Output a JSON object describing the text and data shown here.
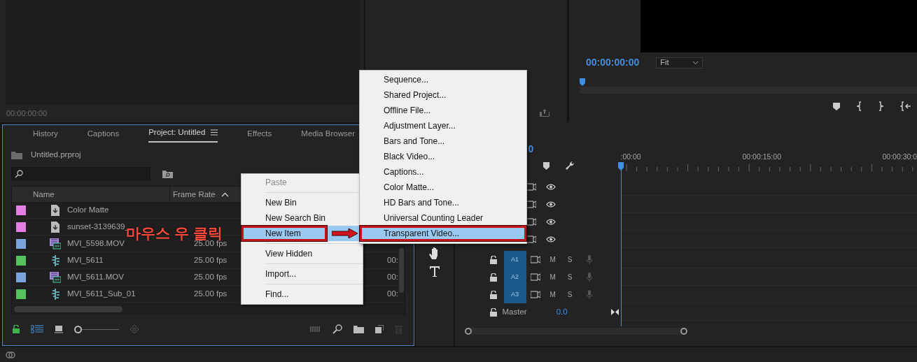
{
  "source_monitor": {
    "timecode": "00:00:00:00"
  },
  "program_monitor": {
    "timecode": "00:00:00:00",
    "zoom": "Fit",
    "scrub": {
      "level": 0
    }
  },
  "project_panel": {
    "tabs": [
      {
        "label": "History",
        "selected": false
      },
      {
        "label": "Captions",
        "selected": false
      },
      {
        "label": "Project: Untitled",
        "selected": true
      },
      {
        "label": "Effects",
        "selected": false
      },
      {
        "label": "Media Browser",
        "selected": false
      }
    ],
    "file": "Untitled.prproj",
    "columns": [
      "Name",
      "Frame Rate"
    ],
    "rows": [
      {
        "name": "Color Matte",
        "kind": "matte",
        "color": "#e27fe0"
      },
      {
        "name": "sunset-3139639_",
        "kind": "matte",
        "color": "#e27fe0"
      },
      {
        "name": "MVI_5598.MOV",
        "kind": "clip",
        "color": "#7ea3dc",
        "frame_rate": "25.00 fps"
      },
      {
        "name": "MVI_5611",
        "kind": "sequence",
        "color": "#55c25f",
        "frame_rate": "25.00 fps",
        "column_3": "00:"
      },
      {
        "name": "MVI_5611.MOV",
        "kind": "clip",
        "color": "#7ea3dc",
        "frame_rate": "25.00 fps",
        "column_3": "00:"
      },
      {
        "name": "MVI_5611_Sub_01",
        "kind": "sequence",
        "color": "#55c25f",
        "frame_rate": "25.00 fps",
        "column_3": "00:"
      }
    ],
    "icon_size": {
      "level": 0
    }
  },
  "timeline": {
    "timecode": "0",
    "ruler": [
      ":00:00",
      "00:00:15:00",
      "00:00:30:0"
    ],
    "video_tracks": [
      {
        "visible": true
      },
      {
        "visible": true
      },
      {
        "visible": true
      },
      {
        "visible": true
      }
    ],
    "audio_tracks": [
      {
        "label": "A1",
        "mute": "M",
        "solo": "S"
      },
      {
        "label": "A2",
        "mute": "M",
        "solo": "S"
      },
      {
        "label": "A3",
        "mute": "M",
        "solo": "S"
      }
    ],
    "master": {
      "label": "Master",
      "value": "0.0"
    }
  },
  "context_menu": {
    "items": [
      {
        "kind": "item",
        "label": "Paste",
        "disabled": true,
        "selected": false
      },
      {
        "kind": "separator"
      },
      {
        "kind": "item",
        "label": "New Bin",
        "disabled": false,
        "selected": false
      },
      {
        "kind": "item",
        "label": "New Search Bin",
        "disabled": false,
        "selected": false
      },
      {
        "kind": "item",
        "label": "New Item",
        "disabled": false,
        "selected": true
      },
      {
        "kind": "separator"
      },
      {
        "kind": "item",
        "label": "View Hidden",
        "disabled": false,
        "selected": false
      },
      {
        "kind": "separator"
      },
      {
        "kind": "item",
        "label": "Import...",
        "disabled": false,
        "selected": false
      },
      {
        "kind": "separator"
      },
      {
        "kind": "item",
        "label": "Find...",
        "disabled": false,
        "selected": false
      }
    ]
  },
  "submenu": {
    "items": [
      {
        "kind": "item",
        "label": "Sequence...",
        "selected": false
      },
      {
        "kind": "item",
        "label": "Shared Project...",
        "selected": false
      },
      {
        "kind": "item",
        "label": "Offline File...",
        "selected": false
      },
      {
        "kind": "item",
        "label": "Adjustment Layer...",
        "selected": false
      },
      {
        "kind": "item",
        "label": "Bars and Tone...",
        "selected": false
      },
      {
        "kind": "item",
        "label": "Black Video...",
        "selected": false
      },
      {
        "kind": "item",
        "label": "Captions...",
        "selected": false
      },
      {
        "kind": "item",
        "label": "Color Matte...",
        "selected": false
      },
      {
        "kind": "item",
        "label": "HD Bars and Tone...",
        "selected": false
      },
      {
        "kind": "item",
        "label": "Universal Counting Leader",
        "selected": false
      },
      {
        "kind": "item",
        "label": "Transparent Video...",
        "selected": true
      }
    ]
  },
  "annotation": {
    "label": "마우스 우 클릭"
  }
}
